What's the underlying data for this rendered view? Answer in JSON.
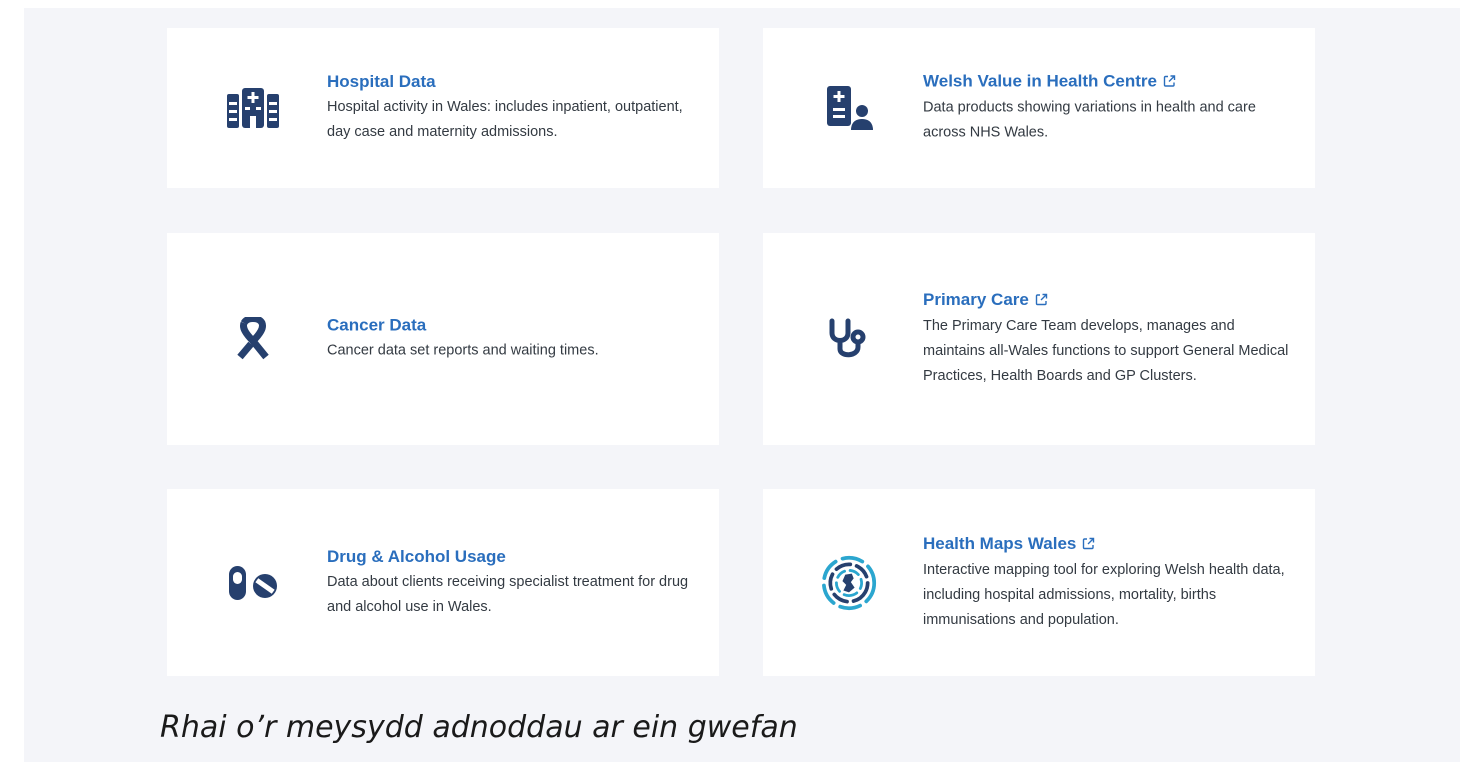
{
  "cards": [
    {
      "title": "Hospital Data",
      "description": "Hospital activity in Wales: includes inpatient, outpatient, day case and maternity admissions.",
      "icon": "hospital-icon",
      "external": false
    },
    {
      "title": "Welsh Value in Health Centre",
      "description": "Data products showing variations in health and care across NHS Wales.",
      "icon": "medical-record-person-icon",
      "external": true
    },
    {
      "title": "Cancer Data",
      "description": "Cancer data set reports and waiting times.",
      "icon": "cancer-ribbon-icon",
      "external": false
    },
    {
      "title": "Primary Care",
      "description": "The Primary Care Team develops, manages and maintains all-Wales functions to support General Medical Practices, Health Boards and GP Clusters.",
      "icon": "stethoscope-icon",
      "external": true
    },
    {
      "title": "Drug & Alcohol Usage",
      "description": "Data about clients receiving specialist treatment for drug and alcohol use in Wales.",
      "icon": "pills-icon",
      "external": false
    },
    {
      "title": "Health Maps Wales",
      "description": "Interactive mapping tool for exploring Welsh health data, including hospital admissions, mortality, births immunisations and population.",
      "icon": "health-maps-wales-logo-icon",
      "external": true
    }
  ],
  "caption": "Rhai o’r meysydd adnoddau ar ein gwefan",
  "colors": {
    "title_link": "#2a6ebd",
    "icon_navy": "#26406e",
    "logo_teal": "#2ba6cf",
    "panel_bg": "#f4f5f9",
    "card_bg": "#ffffff"
  }
}
